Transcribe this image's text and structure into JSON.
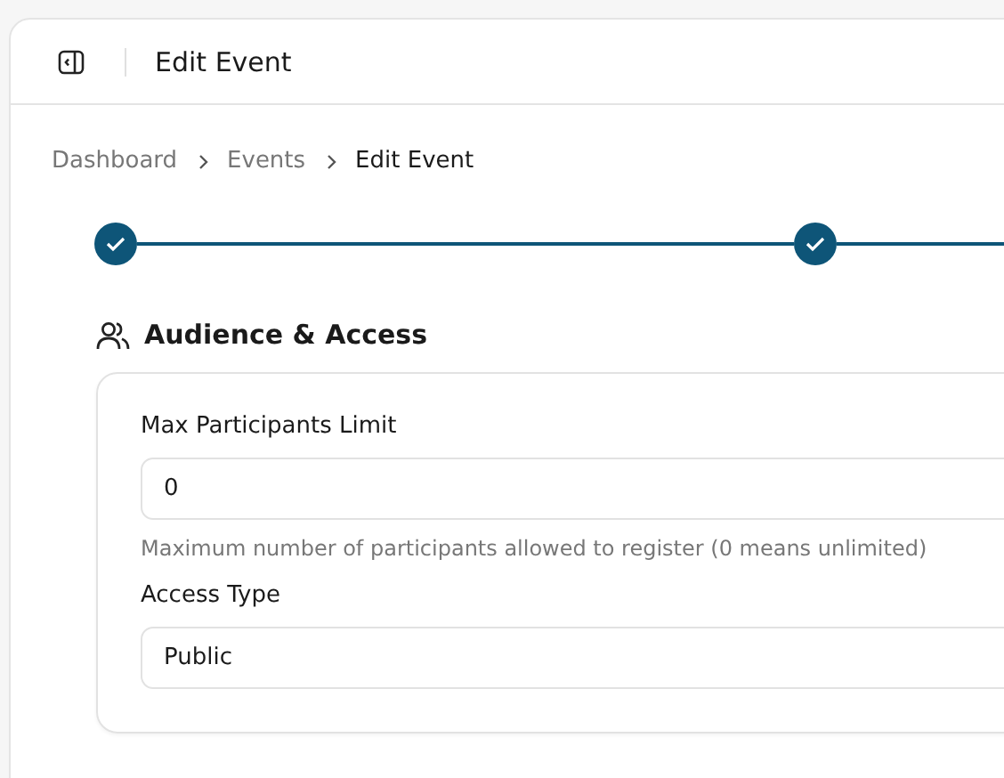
{
  "header": {
    "title": "Edit Event"
  },
  "breadcrumb": [
    {
      "label": "Dashboard",
      "current": false
    },
    {
      "label": "Events",
      "current": false
    },
    {
      "label": "Edit Event",
      "current": true
    }
  ],
  "stepper": [
    {
      "completed": true
    },
    {
      "completed": true
    }
  ],
  "section": {
    "title": "Audience & Access"
  },
  "fields": [
    {
      "label": "Max Participants Limit",
      "value": "0",
      "help": "Maximum number of participants allowed to register (0 means unlimited)"
    },
    {
      "label": "Access Type",
      "value": "Public"
    }
  ]
}
